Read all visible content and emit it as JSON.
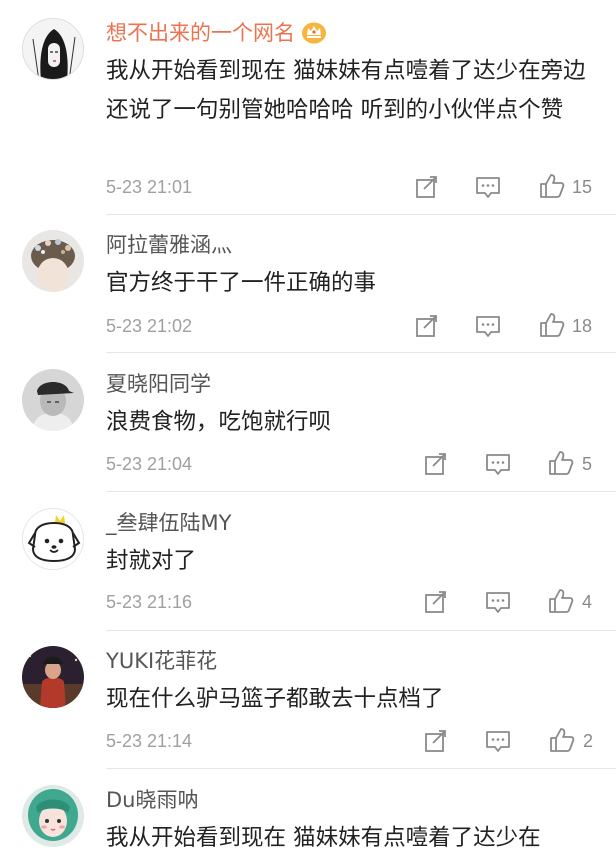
{
  "comments": [
    {
      "username": "想不出来的一个网名",
      "vip": true,
      "text": "我从开始看到现在 猫妹妹有点噎着了达少在旁边还说了一句别管她哈哈哈 听到的小伙伴点个赞",
      "time": "5-23 21:01",
      "likes": "15",
      "avatar_icon": "ink-portrait-icon"
    },
    {
      "username": "阿拉蕾雅涵灬",
      "vip": false,
      "text": "官方终于干了一件正确的事",
      "time": "5-23 21:02",
      "likes": "18",
      "avatar_icon": "flower-hair-portrait-icon"
    },
    {
      "username": "夏晓阳同学",
      "vip": false,
      "text": "浪费食物，吃饱就行呗",
      "time": "5-23 21:04",
      "likes": "5",
      "avatar_icon": "cap-portrait-icon"
    },
    {
      "username": "_叁肆伍陆MY",
      "vip": false,
      "text": "封就对了",
      "time": "5-23 21:16",
      "likes": "4",
      "avatar_icon": "cartoon-dog-icon"
    },
    {
      "username": "YUKI花菲花",
      "vip": false,
      "text": "现在什么驴马篮子都敢去十点档了",
      "time": "5-23 21:14",
      "likes": "2",
      "avatar_icon": "night-portrait-icon"
    },
    {
      "username": "Du晓雨呐",
      "vip": false,
      "text": "我从开始看到现在 猫妹妹有点噎着了达少在",
      "time": "",
      "likes": "",
      "avatar_icon": "green-hair-portrait-icon"
    }
  ],
  "colors": {
    "vip_name": "#eb7350",
    "name": "#555555",
    "text": "#222222",
    "meta": "#a0a0a0",
    "divider": "#e6e6e6"
  }
}
